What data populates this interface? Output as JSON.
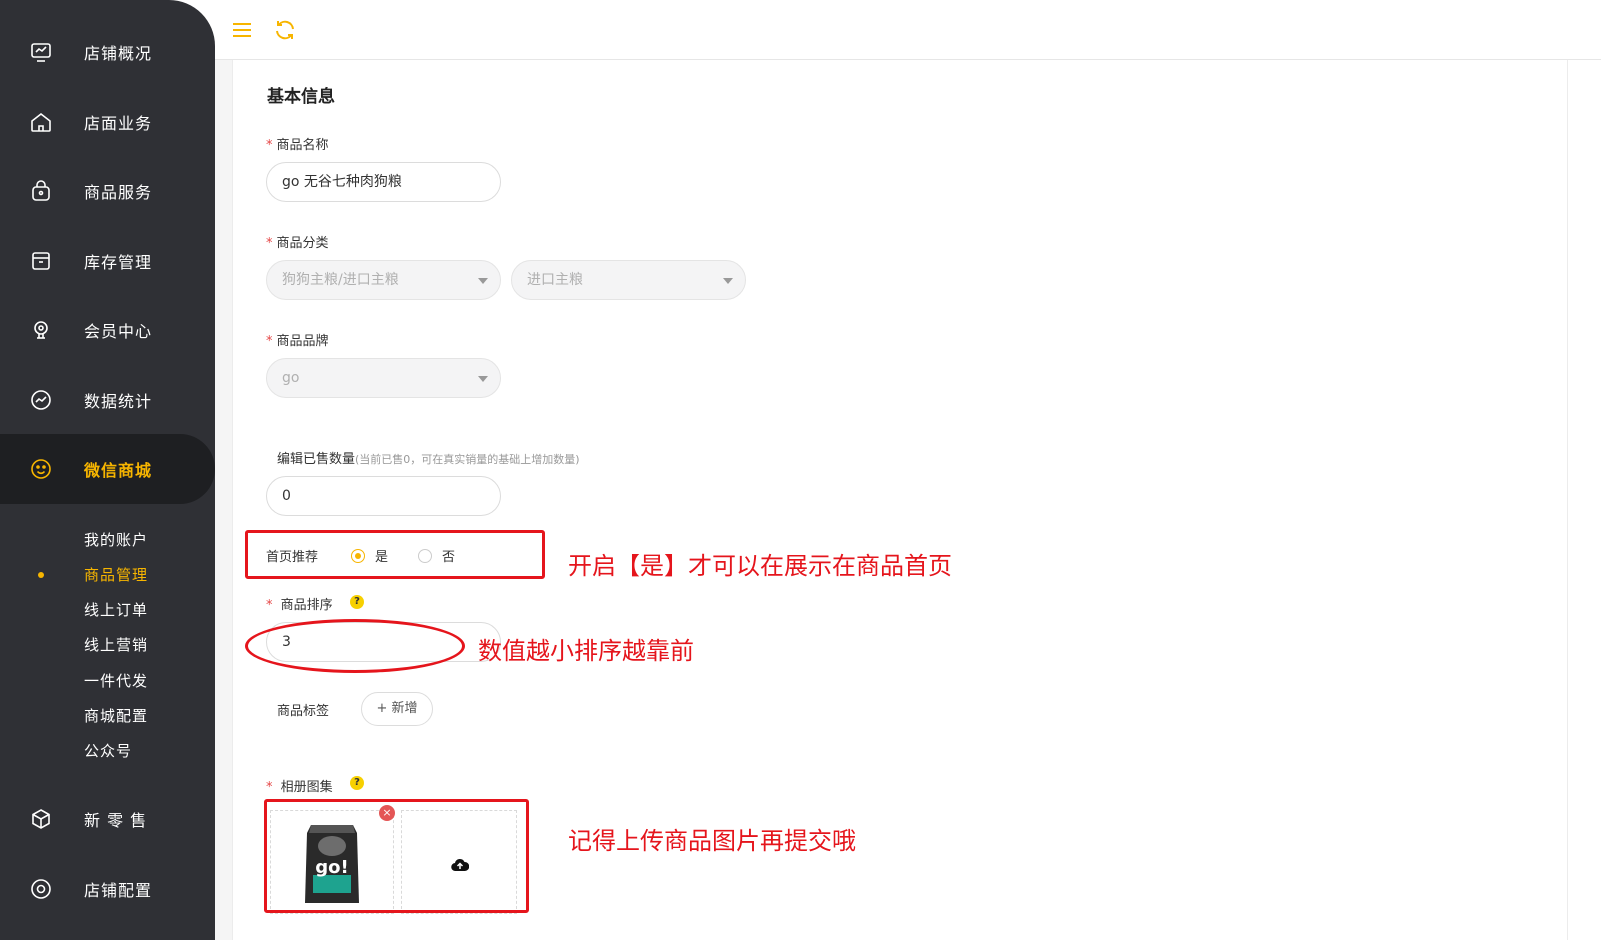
{
  "sidebar": {
    "items": [
      {
        "label": "店铺概况",
        "icon": "monitor-icon"
      },
      {
        "label": "店面业务",
        "icon": "store-icon"
      },
      {
        "label": "商品服务",
        "icon": "bag-icon"
      },
      {
        "label": "库存管理",
        "icon": "box-icon"
      },
      {
        "label": "会员中心",
        "icon": "member-icon"
      },
      {
        "label": "数据统计",
        "icon": "chart-icon"
      },
      {
        "label": "微信商城",
        "icon": "wechat-smile-icon"
      },
      {
        "label": "新 零 售",
        "icon": "cube-icon"
      },
      {
        "label": "店铺配置",
        "icon": "settings-icon"
      }
    ],
    "sub_items": [
      "我的账户",
      "商品管理",
      "线上订单",
      "线上营销",
      "一件代发",
      "商城配置",
      "公众号"
    ],
    "accent": "#f7b500"
  },
  "topbar": {
    "menu_icon": "hamburger-icon",
    "refresh_icon": "refresh-icon"
  },
  "form": {
    "section_title": "基本信息",
    "name": {
      "label": "商品名称",
      "value": "go 无谷七种肉狗粮"
    },
    "category": {
      "label": "商品分类",
      "value1": "狗狗主粮/进口主粮",
      "value2": "进口主粮"
    },
    "brand": {
      "label": "商品品牌",
      "value": "go"
    },
    "sold": {
      "label": "编辑已售数量",
      "hint": "(当前已售0，可在真实销量的基础上增加数量)",
      "value": "0"
    },
    "recommend": {
      "label": "首页推荐",
      "yes": "是",
      "no": "否",
      "selected": "是"
    },
    "sort": {
      "label": "商品排序",
      "value": "3",
      "help": "?"
    },
    "tags": {
      "label": "商品标签",
      "add_label": "+ 新增"
    },
    "album": {
      "label": "相册图集",
      "help": "?",
      "remove": "×",
      "product_brand": "go!"
    }
  },
  "annotations": {
    "recommend_note": "开启【是】才可以在展示在商品首页",
    "sort_note": "数值越小排序越靠前",
    "album_note": "记得上传商品图片再提交哦",
    "color": "#e5151c"
  }
}
